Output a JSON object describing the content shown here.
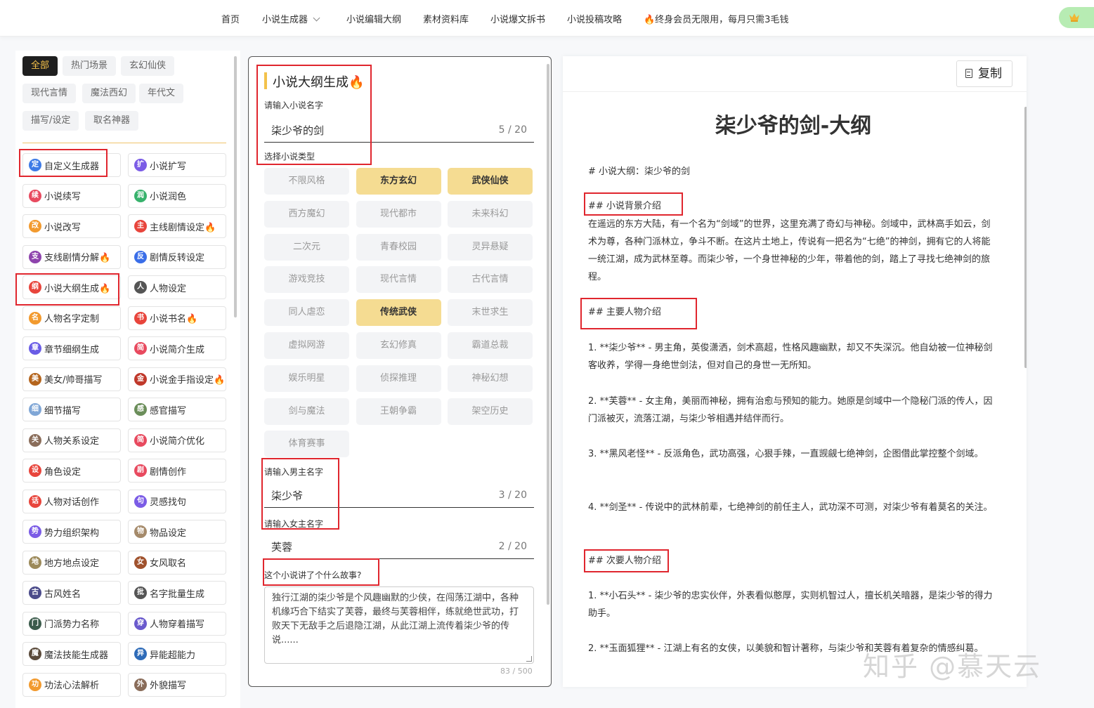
{
  "nav": {
    "items": [
      "首页",
      "小说生成器",
      "小说编辑大纲",
      "素材资料库",
      "小说爆文拆书",
      "小说投稿攻略",
      "🔥终身会员无限用，每月只需3毛钱"
    ]
  },
  "filters": [
    "全部",
    "热门场景",
    "玄幻仙侠",
    "现代言情",
    "魔法西幻",
    "年代文",
    "描写/设定",
    "取名神器"
  ],
  "tools": [
    {
      "label": "自定义生成器",
      "ch": "定",
      "color": "#3e7be6"
    },
    {
      "label": "小说扩写",
      "ch": "扩",
      "color": "#7b5ce6"
    },
    {
      "label": "小说续写",
      "ch": "续",
      "color": "#e84a5f"
    },
    {
      "label": "小说润色",
      "ch": "润",
      "color": "#37b26c"
    },
    {
      "label": "小说改写",
      "ch": "改",
      "color": "#f29a2e"
    },
    {
      "label": "主线剧情设定🔥",
      "ch": "主",
      "color": "#e8453c"
    },
    {
      "label": "支线剧情分解🔥",
      "ch": "支",
      "color": "#8e44ad"
    },
    {
      "label": "剧情反转设定",
      "ch": "反",
      "color": "#3a6ee8"
    },
    {
      "label": "小说大纲生成🔥",
      "ch": "纲",
      "color": "#e8453c"
    },
    {
      "label": "人物设定",
      "ch": "人",
      "color": "#555555"
    },
    {
      "label": "人物名字定制",
      "ch": "名",
      "color": "#f29a2e"
    },
    {
      "label": "小说书名🔥",
      "ch": "书",
      "color": "#e8453c"
    },
    {
      "label": "章节细纲生成",
      "ch": "章",
      "color": "#6a5ce6"
    },
    {
      "label": "小说简介生成",
      "ch": "简",
      "color": "#e84a5f"
    },
    {
      "label": "美女/帅哥描写",
      "ch": "美",
      "color": "#b5651d"
    },
    {
      "label": "小说金手指设定🔥",
      "ch": "金",
      "color": "#c0392b"
    },
    {
      "label": "细节描写",
      "ch": "细",
      "color": "#7fa6d6"
    },
    {
      "label": "感官描写",
      "ch": "感",
      "color": "#6b8e5a"
    },
    {
      "label": "人物关系设定",
      "ch": "关",
      "color": "#8a6d5a"
    },
    {
      "label": "小说简介优化",
      "ch": "简",
      "color": "#e84a5f"
    },
    {
      "label": "角色设定",
      "ch": "设",
      "color": "#e8453c"
    },
    {
      "label": "剧情创作",
      "ch": "剧",
      "color": "#e84a5f"
    },
    {
      "label": "人物对话创作",
      "ch": "话",
      "color": "#e8453c"
    },
    {
      "label": "灵感找句",
      "ch": "句",
      "color": "#7b5ce6"
    },
    {
      "label": "势力组织架构",
      "ch": "势",
      "color": "#7b5ce6"
    },
    {
      "label": "物品设定",
      "ch": "物",
      "color": "#a58a6a"
    },
    {
      "label": "地方地点设定",
      "ch": "地",
      "color": "#9c8a5a"
    },
    {
      "label": "女风取名",
      "ch": "女",
      "color": "#a0522d"
    },
    {
      "label": "古风姓名",
      "ch": "古",
      "color": "#4b4b8a"
    },
    {
      "label": "名字批量生成",
      "ch": "批",
      "color": "#555555"
    },
    {
      "label": "门派势力名称",
      "ch": "门",
      "color": "#3b5b4b"
    },
    {
      "label": "人物穿着描写",
      "ch": "穿",
      "color": "#6a5acd"
    },
    {
      "label": "魔法技能生成器",
      "ch": "魔",
      "color": "#5a4a3a"
    },
    {
      "label": "异能超能力",
      "ch": "异",
      "color": "#2e6bb8"
    },
    {
      "label": "功法心法解析",
      "ch": "功",
      "color": "#f29a2e"
    },
    {
      "label": "外貌描写",
      "ch": "外",
      "color": "#8a6d5a"
    }
  ],
  "form": {
    "title": "小说大纲生成🔥",
    "name_label": "请输入小说名字",
    "name_value": "柒少爷的剑",
    "name_count": "5 / 20",
    "genre_label": "选择小说类型",
    "genres": [
      {
        "label": "不限风格",
        "selected": false
      },
      {
        "label": "东方玄幻",
        "selected": true
      },
      {
        "label": "武侠仙侠",
        "selected": true
      },
      {
        "label": "西方魔幻",
        "selected": false
      },
      {
        "label": "现代都市",
        "selected": false
      },
      {
        "label": "未来科幻",
        "selected": false
      },
      {
        "label": "二次元",
        "selected": false
      },
      {
        "label": "青春校园",
        "selected": false
      },
      {
        "label": "灵异悬疑",
        "selected": false
      },
      {
        "label": "游戏竞技",
        "selected": false
      },
      {
        "label": "现代言情",
        "selected": false
      },
      {
        "label": "古代言情",
        "selected": false
      },
      {
        "label": "同人虐恋",
        "selected": false
      },
      {
        "label": "传统武侠",
        "selected": true
      },
      {
        "label": "末世求生",
        "selected": false
      },
      {
        "label": "虚拟网游",
        "selected": false
      },
      {
        "label": "玄幻修真",
        "selected": false
      },
      {
        "label": "霸道总裁",
        "selected": false
      },
      {
        "label": "娱乐明星",
        "selected": false
      },
      {
        "label": "侦探推理",
        "selected": false
      },
      {
        "label": "神秘幻想",
        "selected": false
      },
      {
        "label": "剑与魔法",
        "selected": false
      },
      {
        "label": "王朝争霸",
        "selected": false
      },
      {
        "label": "架空历史",
        "selected": false
      },
      {
        "label": "体育赛事",
        "selected": false
      }
    ],
    "male_label": "请输入男主名字",
    "male_value": "柒少爷",
    "male_count": "3 / 20",
    "female_label": "请输入女主名字",
    "female_value": "芙蓉",
    "female_count": "2 / 20",
    "story_label": "这个小说讲了个什么故事?",
    "story_value": "独行江湖的柒少爷是个风趣幽默的少侠，在闯荡江湖中，各种机缘巧合下结实了芙蓉，最终与芙蓉相伴，练就绝世武功，打败天下无敌手之后退隐江湖，从此江湖上流传着柒少爷的传说......",
    "story_count": "83 / 500"
  },
  "output": {
    "copy_label": "复制",
    "title": "柒少爷的剑-大纲",
    "lines": [
      "# 小说大纲：柒少爷的剑",
      "## 小说背景介绍",
      "在遥远的东方大陆，有一个名为“剑域”的世界，这里充满了奇幻与神秘。剑域中，武林高手如云，剑术为尊，各种门派林立，争斗不断。在这片土地上，传说有一把名为“七绝”的神剑，拥有它的人将能一统江湖，成为武林至尊。而柒少爷，一个身世神秘的少年，带着他的剑，踏上了寻找七绝神剑的旅程。",
      "## 主要人物介绍",
      "1. **柒少爷** - 男主角，英俊潇洒，剑术高超，性格风趣幽默，却又不失深沉。他自幼被一位神秘剑客收养，学得一身绝世剑法，但对自己的身世一无所知。",
      "2. **芙蓉** - 女主角，美丽而神秘，拥有治愈与预知的能力。她原是剑域中一个隐秘门派的传人，因门派被灭，流落江湖，与柒少爷相遇并结伴而行。",
      "3. **黑风老怪** - 反派角色，武功高强，心狠手辣，一直觊觎七绝神剑，企图借此掌控整个剑域。",
      "4. **剑圣** - 传说中的武林前辈，七绝神剑的前任主人，武功深不可测，对柒少爷有着莫名的关注。",
      "## 次要人物介绍",
      "1. **小石头** - 柒少爷的忠实伙伴，外表看似憨厚，实则机智过人，擅长机关暗器，是柒少爷的得力助手。",
      "2. **玉面狐狸** - 江湖上有名的女侠，以美貌和智计著称，与柒少爷和芙蓉有着复杂的情感纠葛。"
    ]
  },
  "watermark": "知乎 @慕天云"
}
